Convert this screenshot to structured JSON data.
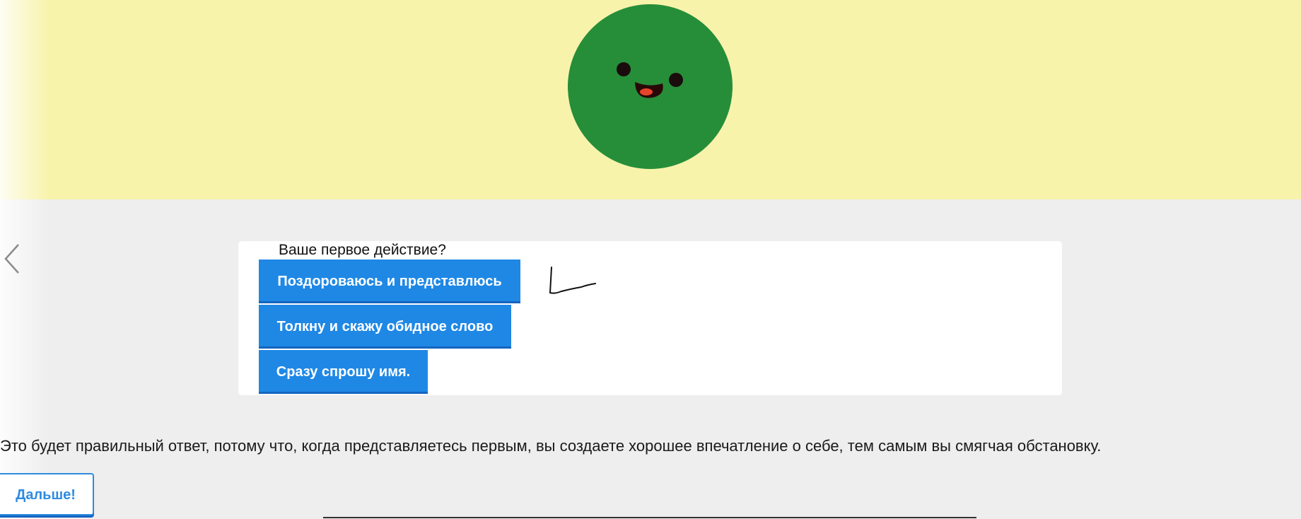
{
  "hero": {
    "background_color": "#f8f3ab",
    "character": {
      "icon": "smiling-green-ball-icon",
      "body_color": "#268e39",
      "eye_color": "#1a0c0c",
      "mouth_color": "#2a0808",
      "tongue_color": "#e8442b"
    }
  },
  "navigation": {
    "back_icon": "chevron-left-icon"
  },
  "quiz": {
    "question": "Ваше первое действие?",
    "options": [
      {
        "label": "Поздороваюсь и представлюсь"
      },
      {
        "label": "Толкну и скажу обидное слово"
      },
      {
        "label": "Сразу спрошу имя."
      }
    ],
    "option_color": "#1f88e5"
  },
  "feedback": {
    "explanation": "Это будет правильный ответ, потому что, когда представляетесь первым, вы создаете хорошее впечатление о себе, тем самым вы смягчая обстановку.",
    "next_label": "Дальше!"
  },
  "colors": {
    "page_background": "#eeeeee",
    "accent": "#2e8be0"
  }
}
